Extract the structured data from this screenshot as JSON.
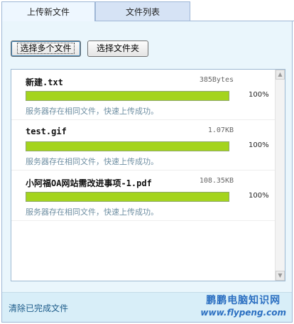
{
  "tabs": [
    {
      "label": "上传新文件",
      "active": true
    },
    {
      "label": "文件列表",
      "active": false
    }
  ],
  "toolbar": {
    "select_multiple_label": "选择多个文件",
    "select_folder_label": "选择文件夹"
  },
  "files": [
    {
      "name": "新建.txt",
      "size": "385Bytes",
      "progress": 100,
      "progress_label": "100%",
      "message": "服务器存在相同文件，快速上传成功。"
    },
    {
      "name": "test.gif",
      "size": "1.07KB",
      "progress": 100,
      "progress_label": "100%",
      "message": "服务器存在相同文件，快速上传成功。"
    },
    {
      "name": "小阿福OA网站需改进事项-1.pdf",
      "size": "108.35KB",
      "progress": 100,
      "progress_label": "100%",
      "message": "服务器存在相同文件，快速上传成功。"
    }
  ],
  "footer": {
    "clear_label": "清除已完成文件",
    "watermark_title": "鹏鹏电脑知识网",
    "watermark_url": "www.flypeng.com"
  },
  "colors": {
    "progress": "#a4d41d",
    "tab_active": "#eef7ff",
    "tab_inactive": "#d6e3f5",
    "panel": "#eaf6fc",
    "footer": "#d8eef8",
    "watermark": "#2b6fc1"
  },
  "icons": {
    "scroll_up": "chevron-up-icon",
    "scroll_down": "chevron-down-icon"
  }
}
